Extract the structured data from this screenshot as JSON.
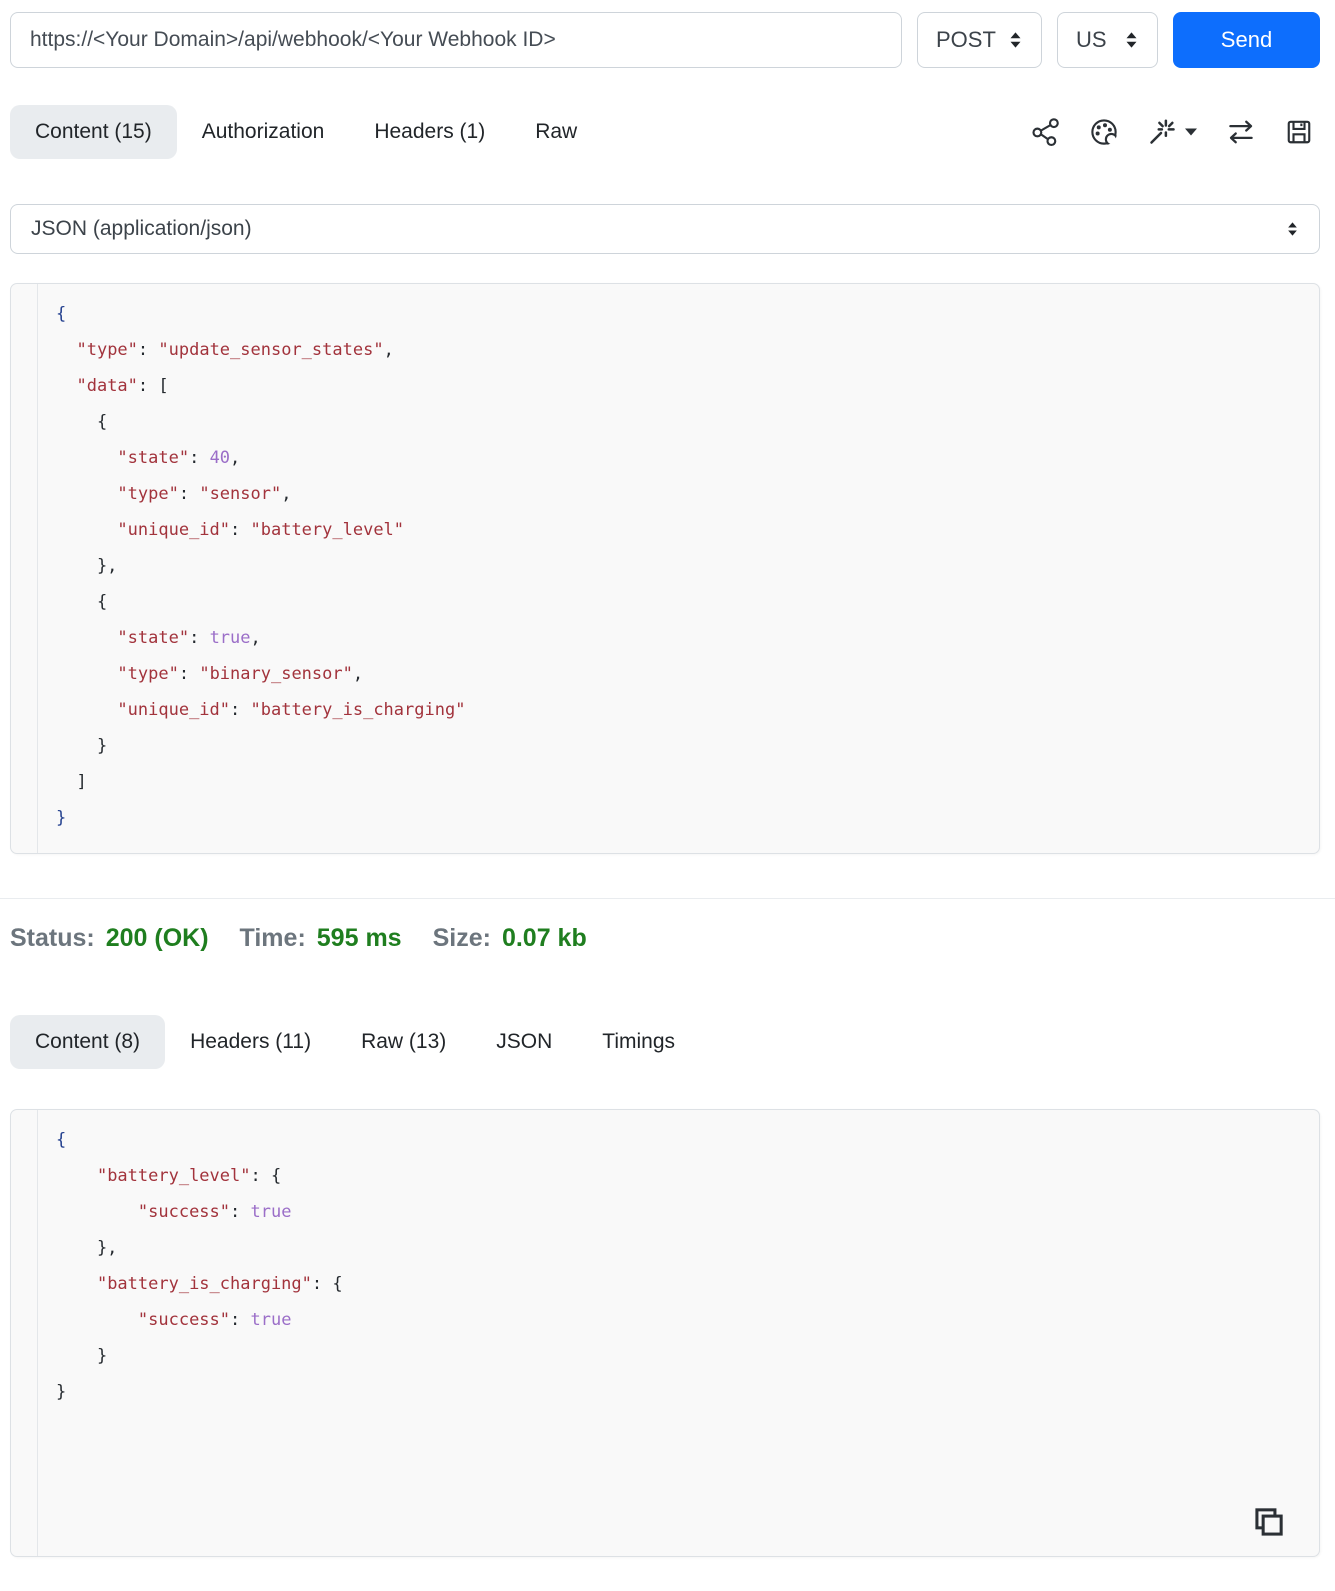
{
  "request": {
    "url": "https://<Your Domain>/api/webhook/<Your Webhook ID>",
    "method": "POST",
    "region": "US",
    "send_label": "Send",
    "tabs": [
      {
        "label": "Content (15)",
        "active": true
      },
      {
        "label": "Authorization",
        "active": false
      },
      {
        "label": "Headers (1)",
        "active": false
      },
      {
        "label": "Raw",
        "active": false
      }
    ],
    "toolbar_icons": [
      {
        "name": "share-icon"
      },
      {
        "name": "palette-icon"
      },
      {
        "name": "magic-wand-icon",
        "has_dropdown": true
      },
      {
        "name": "swap-arrows-icon"
      },
      {
        "name": "save-icon"
      }
    ],
    "content_type": "JSON (application/json)",
    "body_lines": [
      [
        [
          "b",
          "{"
        ]
      ],
      [
        [
          "p",
          "  "
        ],
        [
          "k",
          "\"type\""
        ],
        [
          "p",
          ": "
        ],
        [
          "s",
          "\"update_sensor_states\""
        ],
        [
          "p",
          ","
        ]
      ],
      [
        [
          "p",
          "  "
        ],
        [
          "k",
          "\"data\""
        ],
        [
          "p",
          ": ["
        ]
      ],
      [
        [
          "p",
          "    {"
        ]
      ],
      [
        [
          "p",
          "      "
        ],
        [
          "k",
          "\"state\""
        ],
        [
          "p",
          ": "
        ],
        [
          "n",
          "40"
        ],
        [
          "p",
          ","
        ]
      ],
      [
        [
          "p",
          "      "
        ],
        [
          "k",
          "\"type\""
        ],
        [
          "p",
          ": "
        ],
        [
          "s",
          "\"sensor\""
        ],
        [
          "p",
          ","
        ]
      ],
      [
        [
          "p",
          "      "
        ],
        [
          "k",
          "\"unique_id\""
        ],
        [
          "p",
          ": "
        ],
        [
          "s",
          "\"battery_level\""
        ]
      ],
      [
        [
          "p",
          "    },"
        ]
      ],
      [
        [
          "p",
          "    {"
        ]
      ],
      [
        [
          "p",
          "      "
        ],
        [
          "k",
          "\"state\""
        ],
        [
          "p",
          ": "
        ],
        [
          "n",
          "true"
        ],
        [
          "p",
          ","
        ]
      ],
      [
        [
          "p",
          "      "
        ],
        [
          "k",
          "\"type\""
        ],
        [
          "p",
          ": "
        ],
        [
          "s",
          "\"binary_sensor\""
        ],
        [
          "p",
          ","
        ]
      ],
      [
        [
          "p",
          "      "
        ],
        [
          "k",
          "\"unique_id\""
        ],
        [
          "p",
          ": "
        ],
        [
          "s",
          "\"battery_is_charging\""
        ]
      ],
      [
        [
          "p",
          "    }"
        ]
      ],
      [
        [
          "p",
          "  ]"
        ]
      ],
      [
        [
          "b",
          "}"
        ]
      ]
    ]
  },
  "response": {
    "status": {
      "label": "Status:",
      "value": "200 (OK)"
    },
    "time": {
      "label": "Time:",
      "value": "595 ms"
    },
    "size": {
      "label": "Size:",
      "value": "0.07 kb"
    },
    "tabs": [
      {
        "label": "Content (8)",
        "active": true
      },
      {
        "label": "Headers (11)",
        "active": false
      },
      {
        "label": "Raw (13)",
        "active": false
      },
      {
        "label": "JSON",
        "active": false
      },
      {
        "label": "Timings",
        "active": false
      }
    ],
    "copy_icon": "copy-icon",
    "body_lines": [
      [
        [
          "b",
          "{"
        ]
      ],
      [
        [
          "p",
          "    "
        ],
        [
          "k",
          "\"battery_level\""
        ],
        [
          "p",
          ": {"
        ]
      ],
      [
        [
          "p",
          "        "
        ],
        [
          "k",
          "\"success\""
        ],
        [
          "p",
          ": "
        ],
        [
          "n",
          "true"
        ]
      ],
      [
        [
          "p",
          "    },"
        ]
      ],
      [
        [
          "p",
          "    "
        ],
        [
          "k",
          "\"battery_is_charging\""
        ],
        [
          "p",
          ": {"
        ]
      ],
      [
        [
          "p",
          "        "
        ],
        [
          "k",
          "\"success\""
        ],
        [
          "p",
          ": "
        ],
        [
          "n",
          "true"
        ]
      ],
      [
        [
          "p",
          "    }"
        ]
      ],
      [
        [
          "p",
          "}"
        ]
      ]
    ]
  },
  "colors": {
    "accent_blue": "#0d6efd",
    "status_green": "#1f7e1f",
    "label_grey": "#6c757d",
    "active_tab_bg": "#e9ecef",
    "syntax_key_string": "#a2333c",
    "syntax_number_bool": "#9b6ec8",
    "syntax_punctuation": "#24292e",
    "syntax_matched_bracket": "#24418f",
    "editor_bg": "#f9f9f9"
  }
}
